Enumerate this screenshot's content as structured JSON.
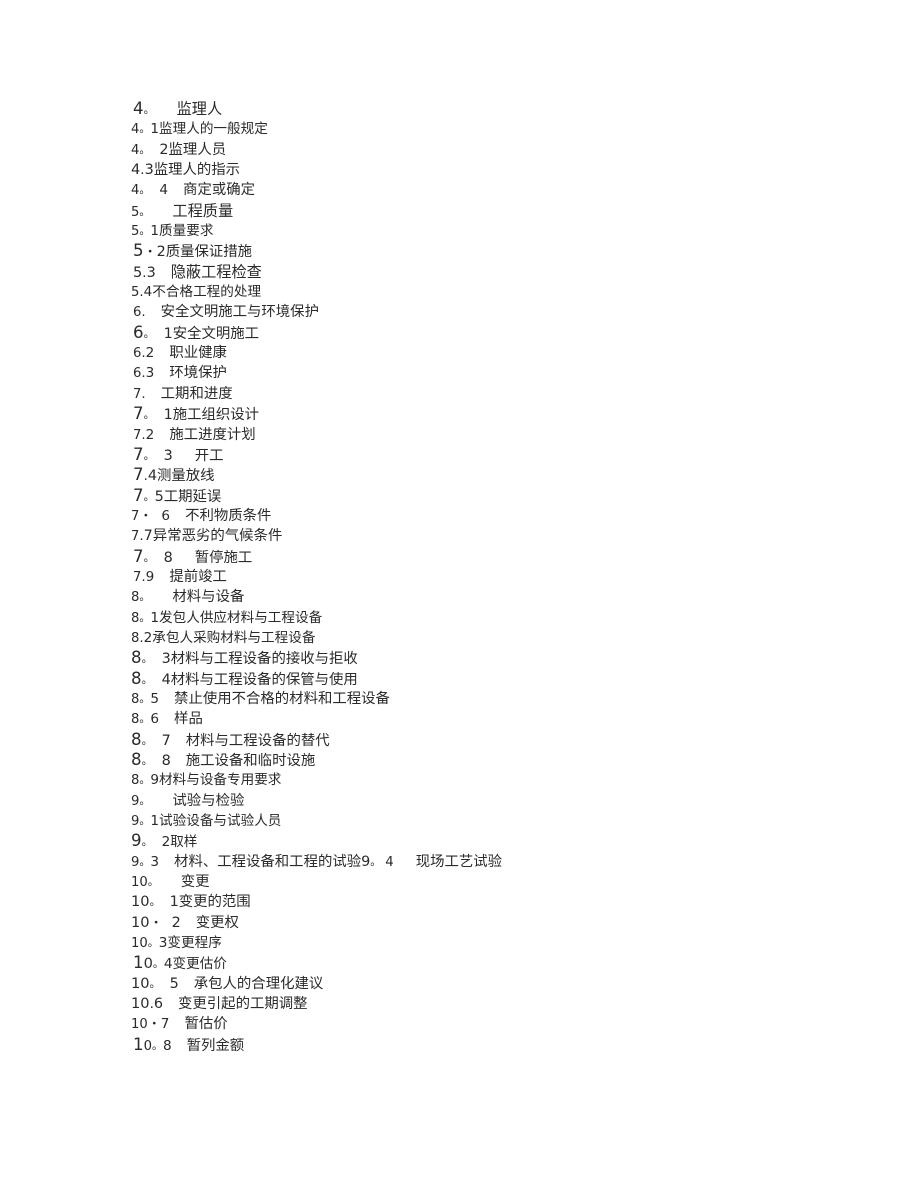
{
  "document": {
    "type": "table-of-contents",
    "language": "zh-CN",
    "background_color": "#ffffff",
    "text_color": "#2b2b2b",
    "lines": [
      {
        "id": "l01",
        "number": "4",
        "sep": "。",
        "sep_kind": "deg",
        "gap": 3,
        "title": "监理人",
        "num_size": "lg",
        "text_size": "lg",
        "indent": 1
      },
      {
        "id": "l02",
        "number": "4",
        "sep": "。",
        "sep_kind": "deg",
        "gap": 0,
        "title": "1监理人的一般规定",
        "num_size": "sm",
        "text_size": "sm",
        "indent": 0
      },
      {
        "id": "l03",
        "number": "4",
        "sep": "。",
        "sep_kind": "deg",
        "gap": 1,
        "title": "2监理人员",
        "num_size": "sm",
        "text_size": "md",
        "indent": 0
      },
      {
        "id": "l04",
        "number": "4",
        "sep": ".",
        "sep_kind": "dot",
        "gap": 0,
        "title": "3监理人的指示",
        "num_size": "md",
        "text_size": "md",
        "indent": 0
      },
      {
        "id": "l05",
        "number": "4",
        "sep": "。",
        "sep_kind": "deg",
        "gap": 1,
        "title": "4",
        "num_size": "sm",
        "text_size": "sm",
        "indent": 0,
        "tail_gap": 2,
        "tail": "商定或确定",
        "tail_size": "md"
      },
      {
        "id": "l06",
        "number": "5",
        "sep": "。",
        "sep_kind": "deg",
        "gap": 3,
        "title": "工程质量",
        "num_size": "sm",
        "text_size": "lg",
        "indent": 0
      },
      {
        "id": "l07",
        "number": "5",
        "sep": "。",
        "sep_kind": "deg",
        "gap": 0,
        "title": "1质量要求",
        "num_size": "sm",
        "text_size": "sm",
        "indent": 0
      },
      {
        "id": "l08",
        "number": "5",
        "sep": "・",
        "sep_kind": "mid",
        "gap": 0,
        "title": "2质量保证措施",
        "num_size": "lg",
        "text_size": "md",
        "indent": 1
      },
      {
        "id": "l09",
        "number": "5",
        "sep": ".",
        "sep_kind": "dot",
        "gap": 0,
        "title": "3",
        "num_size": "md",
        "text_size": "md",
        "indent": 1,
        "tail_gap": 2,
        "tail": "隐蔽工程检查",
        "tail_size": "lg"
      },
      {
        "id": "l10",
        "number": "5",
        "sep": ".",
        "sep_kind": "dot",
        "gap": 0,
        "title": "4不合格工程的处理",
        "num_size": "sm",
        "text_size": "sm",
        "indent": 0
      },
      {
        "id": "l11",
        "number": "6",
        "sep": ".",
        "sep_kind": "dot",
        "gap": 2,
        "title": "安全文明施工与环境保护",
        "num_size": "sm",
        "text_size": "md",
        "indent": 1
      },
      {
        "id": "l12",
        "number": "6",
        "sep": "。",
        "sep_kind": "deg",
        "gap": 1,
        "title": "1安全文明施工",
        "num_size": "lg",
        "text_size": "md",
        "indent": 1
      },
      {
        "id": "l13",
        "number": "6",
        "sep": ".",
        "sep_kind": "dot",
        "gap": 0,
        "title": "2",
        "num_size": "sm",
        "text_size": "sm",
        "indent": 1,
        "tail_gap": 2,
        "tail": "职业健康",
        "tail_size": "md"
      },
      {
        "id": "l14",
        "number": "6",
        "sep": ".",
        "sep_kind": "dot",
        "gap": 0,
        "title": "3",
        "num_size": "sm",
        "text_size": "sm",
        "indent": 1,
        "tail_gap": 2,
        "tail": "环境保护",
        "tail_size": "md"
      },
      {
        "id": "l15",
        "number": "7",
        "sep": ".",
        "sep_kind": "dot",
        "gap": 2,
        "title": "工期和进度",
        "num_size": "sm",
        "text_size": "md",
        "indent": 1
      },
      {
        "id": "l16",
        "number": "7",
        "sep": "。",
        "sep_kind": "deg",
        "gap": 1,
        "title": "1施工组织设计",
        "num_size": "lg",
        "text_size": "md",
        "indent": 1
      },
      {
        "id": "l17",
        "number": "7",
        "sep": ".",
        "sep_kind": "dot",
        "gap": 0,
        "title": "2",
        "num_size": "sm",
        "text_size": "sm",
        "indent": 1,
        "tail_gap": 2,
        "tail": "施工进度计划",
        "tail_size": "md"
      },
      {
        "id": "l18",
        "number": "7",
        "sep": "。",
        "sep_kind": "deg",
        "gap": 1,
        "title": "3",
        "num_size": "lg",
        "text_size": "md",
        "indent": 1,
        "tail_gap": 3,
        "tail": "开工",
        "tail_size": "md"
      },
      {
        "id": "l19",
        "number": "7",
        "sep": ".",
        "sep_kind": "dot",
        "gap": 0,
        "title": "4测量放线",
        "num_size": "lg",
        "text_size": "md",
        "indent": 1
      },
      {
        "id": "l20",
        "number": "7",
        "sep": "。",
        "sep_kind": "deg",
        "gap": 0,
        "title": "5工期延误",
        "num_size": "lg",
        "text_size": "md",
        "indent": 1
      },
      {
        "id": "l21",
        "number": "7",
        "sep": "・",
        "sep_kind": "mid",
        "gap": 1,
        "title": "6",
        "num_size": "sm",
        "text_size": "sm",
        "indent": 0,
        "tail_gap": 2,
        "tail": "不利物质条件",
        "tail_size": "md"
      },
      {
        "id": "l22",
        "number": "7",
        "sep": ".",
        "sep_kind": "dot",
        "gap": 0,
        "title": "7异常恶劣的气候条件",
        "num_size": "sm",
        "text_size": "md",
        "indent": 0
      },
      {
        "id": "l23",
        "number": "7",
        "sep": "。",
        "sep_kind": "deg",
        "gap": 1,
        "title": "8",
        "num_size": "lg",
        "text_size": "md",
        "indent": 1,
        "tail_gap": 3,
        "tail": "暂停施工",
        "tail_size": "md"
      },
      {
        "id": "l24",
        "number": "7",
        "sep": ".",
        "sep_kind": "dot",
        "gap": 0,
        "title": "9",
        "num_size": "sm",
        "text_size": "sm",
        "indent": 1,
        "tail_gap": 2,
        "tail": "提前竣工",
        "tail_size": "md"
      },
      {
        "id": "l25",
        "number": "8",
        "sep": "。",
        "sep_kind": "deg",
        "gap": 3,
        "title": "材料与设备",
        "num_size": "sm",
        "text_size": "md",
        "indent": 0
      },
      {
        "id": "l26",
        "number": "8",
        "sep": "。",
        "sep_kind": "deg",
        "gap": 0,
        "title": "1发包人供应材料与工程设备",
        "num_size": "sm",
        "text_size": "sm",
        "indent": 0
      },
      {
        "id": "l27",
        "number": "8",
        "sep": ".",
        "sep_kind": "dot",
        "gap": 0,
        "title": "2承包人采购材料与工程设备",
        "num_size": "sm",
        "text_size": "sm",
        "indent": 0
      },
      {
        "id": "l28",
        "number": "8",
        "sep": "。",
        "sep_kind": "deg",
        "gap": 1,
        "title": "3材料与工程设备的接收与拒收",
        "num_size": "lg",
        "text_size": "md",
        "indent": 0
      },
      {
        "id": "l29",
        "number": "8",
        "sep": "。",
        "sep_kind": "deg",
        "gap": 1,
        "title": "4材料与工程设备的保管与使用",
        "num_size": "lg",
        "text_size": "md",
        "indent": 0
      },
      {
        "id": "l30",
        "number": "8",
        "sep": "。",
        "sep_kind": "deg",
        "gap": 0,
        "title": "5",
        "num_size": "sm",
        "text_size": "sm",
        "indent": 0,
        "tail_gap": 2,
        "tail": "禁止使用不合格的材料和工程设备",
        "tail_size": "md"
      },
      {
        "id": "l31",
        "number": "8",
        "sep": "。",
        "sep_kind": "deg",
        "gap": 0,
        "title": "6",
        "num_size": "sm",
        "text_size": "sm",
        "indent": 0,
        "tail_gap": 2,
        "tail": "样品",
        "tail_size": "md"
      },
      {
        "id": "l32",
        "number": "8",
        "sep": "。",
        "sep_kind": "deg",
        "gap": 1,
        "title": "7",
        "num_size": "lg",
        "text_size": "md",
        "indent": 0,
        "tail_gap": 2,
        "tail": "材料与工程设备的替代",
        "tail_size": "md"
      },
      {
        "id": "l33",
        "number": "8",
        "sep": "。",
        "sep_kind": "deg",
        "gap": 1,
        "title": "8",
        "num_size": "lg",
        "text_size": "md",
        "indent": 0,
        "tail_gap": 2,
        "tail": "施工设备和临时设施",
        "tail_size": "md"
      },
      {
        "id": "l34",
        "number": "8",
        "sep": "。",
        "sep_kind": "deg",
        "gap": 0,
        "title": "9材料与设备专用要求",
        "num_size": "sm",
        "text_size": "sm",
        "indent": 0
      },
      {
        "id": "l35",
        "number": "9",
        "sep": "。",
        "sep_kind": "deg",
        "gap": 3,
        "title": "试验与检验",
        "num_size": "sm",
        "text_size": "md",
        "indent": 0
      },
      {
        "id": "l36",
        "number": "9",
        "sep": "。",
        "sep_kind": "deg",
        "gap": 0,
        "title": "1试验设备与试验人员",
        "num_size": "sm",
        "text_size": "sm",
        "indent": 0
      },
      {
        "id": "l37",
        "number": "9",
        "sep": "。",
        "sep_kind": "deg",
        "gap": 1,
        "title": "2取样",
        "num_size": "lg",
        "text_size": "sm",
        "indent": 0
      },
      {
        "id": "l38",
        "number": "9",
        "sep": "。",
        "sep_kind": "deg",
        "gap": 0,
        "title": "3",
        "num_size": "sm",
        "text_size": "sm",
        "indent": 0,
        "tail_gap": 2,
        "tail": "材料、工程设备和工程的试验9",
        "tail_size": "md",
        "extra_sep": "。",
        "extra_num": "4",
        "extra_gap": 3,
        "extra_tail": "现场工艺试验"
      },
      {
        "id": "l39",
        "number": "10",
        "sep": "。",
        "sep_kind": "deg",
        "gap": 3,
        "title": "变更",
        "num_size": "sm",
        "text_size": "md",
        "indent": 0
      },
      {
        "id": "l40",
        "number": "10",
        "sep": "。",
        "sep_kind": "deg",
        "gap": 1,
        "title": "1变更的范围",
        "num_size": "md",
        "text_size": "md",
        "indent": 0
      },
      {
        "id": "l41",
        "number": "10",
        "sep": "・",
        "sep_kind": "mid",
        "gap": 1,
        "title": "2",
        "num_size": "md",
        "text_size": "md",
        "indent": 0,
        "tail_gap": 2,
        "tail": "变更权",
        "tail_size": "md"
      },
      {
        "id": "l42",
        "number": "10",
        "sep": "。",
        "sep_kind": "deg",
        "gap": 0,
        "title": "3变更程序",
        "num_size": "sm",
        "text_size": "sm",
        "indent": 0
      },
      {
        "id": "l43",
        "number": "10",
        "sep": "。",
        "sep_kind": "deg",
        "gap": 0,
        "title": "4变更估价",
        "num_size": "md",
        "text_size": "sm",
        "indent": 1,
        "first_big": true
      },
      {
        "id": "l44",
        "number": "10",
        "sep": "。",
        "sep_kind": "deg",
        "gap": 1,
        "title": "5",
        "num_size": "md",
        "text_size": "md",
        "indent": 0,
        "tail_gap": 2,
        "tail": "承包人的合理化建议",
        "tail_size": "md"
      },
      {
        "id": "l45",
        "number": "10",
        "sep": ".",
        "sep_kind": "dot",
        "gap": 0,
        "title": "6",
        "num_size": "md",
        "text_size": "md",
        "indent": 0,
        "tail_gap": 2,
        "tail": "变更引起的工期调整",
        "tail_size": "md"
      },
      {
        "id": "l46",
        "number": "10",
        "sep": "・",
        "sep_kind": "mid",
        "gap": 0,
        "title": "7",
        "num_size": "sm",
        "text_size": "sm",
        "indent": 0,
        "tail_gap": 2,
        "tail": "暂估价",
        "tail_size": "md"
      },
      {
        "id": "l47",
        "number": "10",
        "sep": "。",
        "sep_kind": "deg",
        "gap": 0,
        "title": "8",
        "num_size": "sm",
        "text_size": "sm",
        "indent": 1,
        "first_big": true,
        "tail_gap": 2,
        "tail": "暂列金额",
        "tail_size": "md"
      }
    ]
  }
}
